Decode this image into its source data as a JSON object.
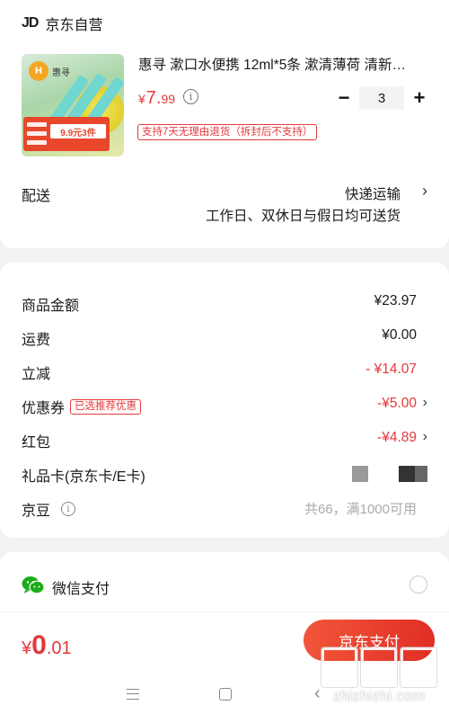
{
  "store": {
    "logo": "JD",
    "name": "京东自营"
  },
  "product": {
    "image_brand": "惠寻",
    "image_promo": "9.9元3件",
    "title": "惠寻 漱口水便携 12ml*5条 漱清薄荷 清新…",
    "price_currency": "¥",
    "price_int": "7.",
    "price_dec": "99",
    "return_policy": "支持7天无理由退货（拆封后不支持）",
    "quantity": "3"
  },
  "shipping": {
    "label": "配送",
    "method": "快递运输",
    "time": "工作日、双休日与假日均可送货"
  },
  "summary": {
    "goods_amount": {
      "label": "商品金额",
      "value": "¥23.97"
    },
    "freight": {
      "label": "运费",
      "value": "¥0.00"
    },
    "discount": {
      "label": "立减",
      "value": "- ¥14.07"
    },
    "coupon": {
      "label": "优惠券",
      "badge": "已选推荐优惠",
      "value": "-¥5.00"
    },
    "red_packet": {
      "label": "红包",
      "value": "-¥4.89"
    },
    "gift_card": {
      "label": "礼品卡(京东卡/E卡)"
    },
    "jd_bean": {
      "label": "京豆",
      "value": "共66，满1000可用"
    }
  },
  "payment": {
    "wechat_label": "微信支付"
  },
  "bottom": {
    "total_currency": "¥",
    "total_int": "0",
    "total_dec": ".01",
    "pay_button": "京东支付"
  },
  "watermark": {
    "text": "zhizhizhi.com"
  },
  "colors": {
    "accent": "#e4393c",
    "wechat": "#1aad19"
  }
}
